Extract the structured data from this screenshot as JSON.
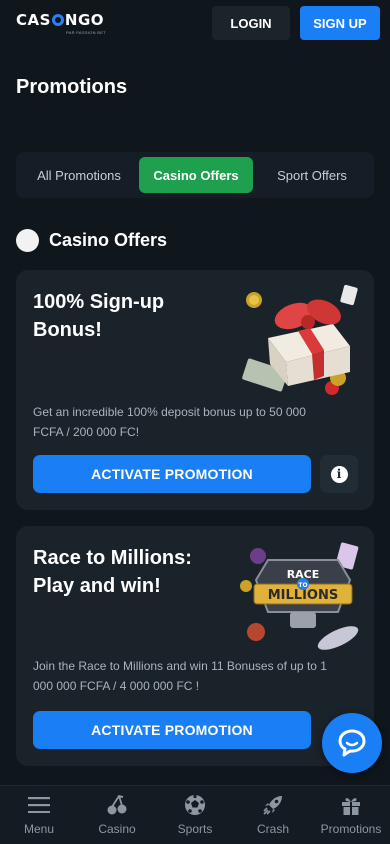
{
  "header": {
    "logo_text_left": "CAS",
    "logo_text_right": "NGO",
    "logo_tagline": "PAR PASSION BET",
    "login_label": "LOGIN",
    "signup_label": "SIGN UP"
  },
  "page": {
    "title": "Promotions"
  },
  "tabs": [
    {
      "label": "All Promotions",
      "active": false
    },
    {
      "label": "Casino Offers",
      "active": true
    },
    {
      "label": "Sport Offers",
      "active": false
    }
  ],
  "section": {
    "title": "Casino Offers"
  },
  "promotions": [
    {
      "title_line1": "100% Sign-up",
      "title_line2": "Bonus!",
      "description": "Get an incredible 100% deposit bonus up to 50 000 FCFA / 200 000 FC!",
      "button_label": "ACTIVATE PROMOTION",
      "art": "gift-box-image"
    },
    {
      "title_line1": "Race to Millions:",
      "title_line2": "Play and win!",
      "description": "Join the Race to Millions and win 11 Bonuses of up to 1 000 000 FCFA / 4 000 000 FC !",
      "button_label": "ACTIVATE PROMOTION",
      "art": "race-to-millions-image",
      "art_text_top": "RACE",
      "art_text_mid": "TO",
      "art_text_bottom": "MILLIONS"
    }
  ],
  "bottom_nav": [
    {
      "label": "Menu",
      "icon": "hamburger-icon"
    },
    {
      "label": "Casino",
      "icon": "cherry-icon"
    },
    {
      "label": "Sports",
      "icon": "soccer-ball-icon"
    },
    {
      "label": "Crash",
      "icon": "rocket-icon"
    },
    {
      "label": "Promotions",
      "icon": "gift-icon"
    }
  ],
  "colors": {
    "background": "#0f161c",
    "card": "#1a222a",
    "accent_blue": "#1a7ff5",
    "active_tab_green": "#1fa04f"
  }
}
